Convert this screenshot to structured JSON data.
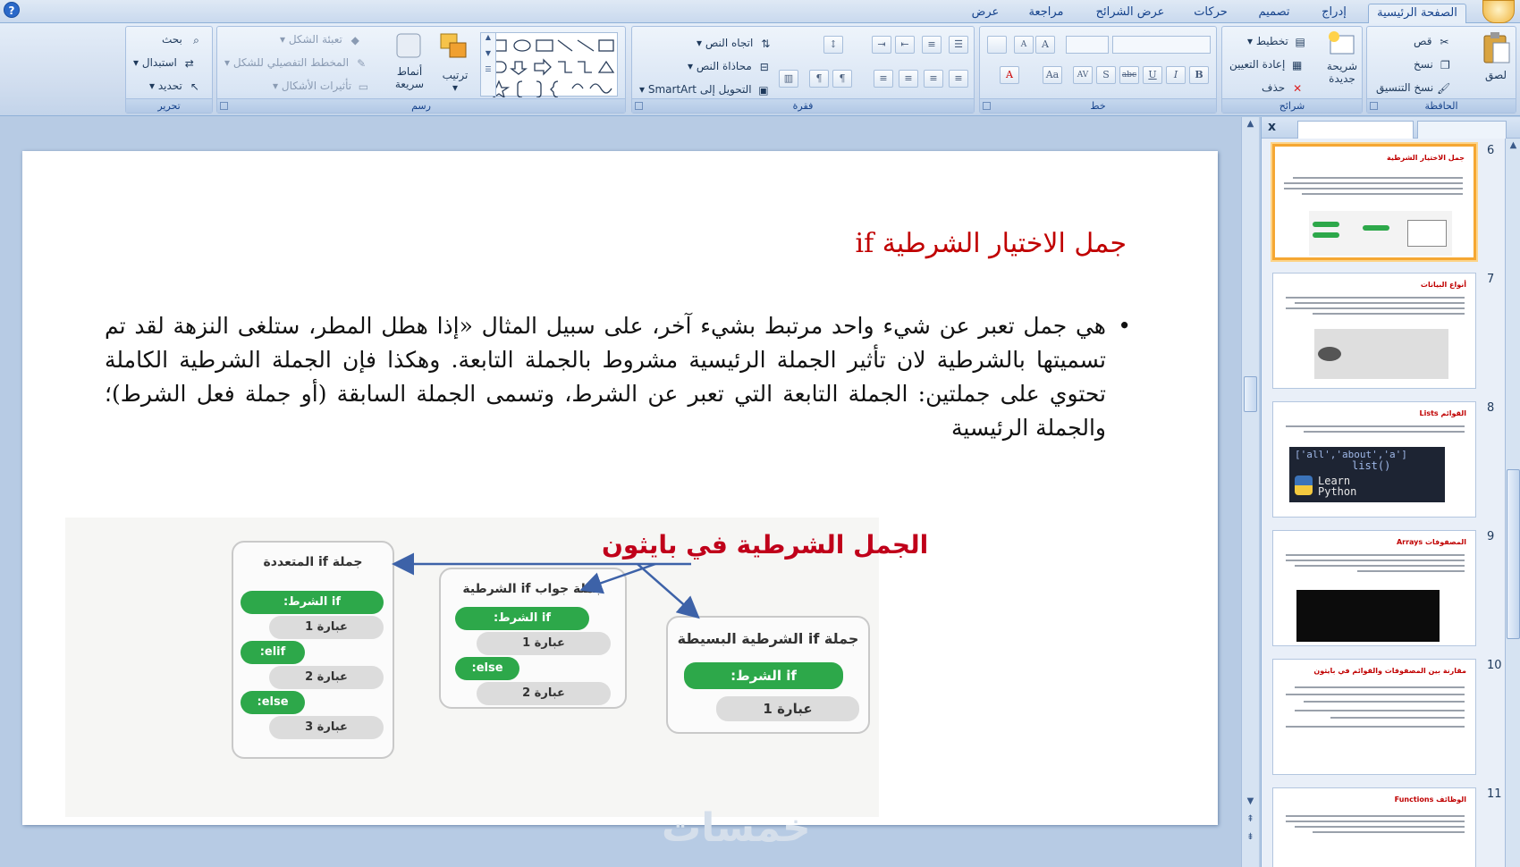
{
  "ribbon_tabs": [
    {
      "label": "الصفحة الرئيسية",
      "active": true
    },
    {
      "label": "إدراج"
    },
    {
      "label": "تصميم"
    },
    {
      "label": "حركات"
    },
    {
      "label": "عرض الشرائح"
    },
    {
      "label": "مراجعة"
    },
    {
      "label": "عرض"
    }
  ],
  "clipboard": {
    "label": "الحافظة",
    "paste": "لصق",
    "cut": "قص",
    "copy": "نسخ",
    "format_painter": "نسخ التنسيق"
  },
  "slides_group": {
    "label": "شرائح",
    "new_slide": "شريحة جديدة",
    "layout": "تخطيط",
    "reset": "إعادة التعيين",
    "delete": "حذف"
  },
  "font_group": {
    "label": "خط",
    "bold": "B",
    "italic": "I",
    "underline": "U",
    "strike": "abc",
    "shadow": "S",
    "spacing": "AV",
    "case": "Aa",
    "color": "A",
    "grow": "A",
    "shrink": "A"
  },
  "paragraph_group": {
    "label": "فقرة",
    "text_direction": "اتجاه النص",
    "align_text": "محاذاة النص",
    "smartart": "التحويل إلى SmartArt"
  },
  "drawing_group": {
    "label": "رسم",
    "arrange": "ترتيب",
    "quick_styles": "أنماط سريعة",
    "shape_fill": "تعبئة الشكل",
    "shape_outline": "المخطط التفصيلي للشكل",
    "shape_effects": "تأثيرات الأشكال"
  },
  "editing_group": {
    "label": "تحرير",
    "find": "بحث",
    "replace": "استبدال",
    "select": "تحديد"
  },
  "slide": {
    "title": "جمل الاختيار الشرطية if",
    "bullet": "•",
    "body": "هي جمل تعبر عن شيء واحد مرتبط بشيء آخر، على سبيل المثال «إذا هطل المطر، ستلغى النزهة لقد تم تسميتها بالشرطية لان تأثير الجملة الرئيسية مشروط بالجملة التابعة. وهكذا فإن الجملة الشرطية الكاملة تحتوي على جملتين: الجملة التابعة التي تعبر عن الشرط، وتسمى الجملة السابقة (أو جملة فعل الشرط)؛ والجملة الرئيسية",
    "diagram": {
      "title": "الجمل الشرطية في بايثون",
      "box_simple": {
        "title": "جملة if الشرطية البسيطة",
        "cond": "if الشرط:",
        "stmt": "عبارة 1"
      },
      "box_ifelse": {
        "title": "جملة جواب if الشرطية",
        "cond": "if الشرط:",
        "stmt1": "عبارة 1",
        "else": "else:",
        "stmt2": "عبارة 2"
      },
      "box_elif": {
        "title": "جملة if المتعددة",
        "cond": "if الشرط:",
        "stmt1": "عبارة 1",
        "elif": "elif:",
        "stmt2": "عبارة 2",
        "else": "else:",
        "stmt3": "عبارة 3"
      }
    }
  },
  "watermark": "خمسات",
  "slides_pane": {
    "close": "x",
    "thumbnails": [
      {
        "number": "6",
        "title": "جمل الاختيار الشرطية",
        "selected": true
      },
      {
        "number": "7",
        "title": "أنواع البيانات"
      },
      {
        "number": "8",
        "title": "القوائم Lists",
        "code": "['all','about','a']",
        "code2": "list()",
        "logo": "Learn Python"
      },
      {
        "number": "9",
        "title": "المصفوفات Arrays"
      },
      {
        "number": "10",
        "title": "مقارنة بين المصفوفات والقوائم في بايثون"
      },
      {
        "number": "11",
        "title": "الوظائف Functions"
      }
    ]
  }
}
